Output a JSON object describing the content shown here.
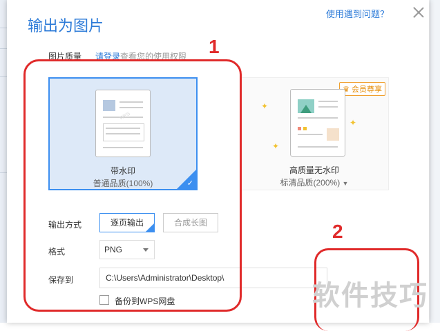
{
  "dialog": {
    "title": "输出为图片",
    "help_link": "使用遇到问题？",
    "quality_label": "图片质量",
    "login_hint_link": "请登录",
    "login_hint_rest": "查看您的使用权限"
  },
  "quality_options": [
    {
      "title": "带水印",
      "subtitle": "普通品质(100%)",
      "selected": true
    },
    {
      "title": "高质量无水印",
      "subtitle": "标清品质(200%)",
      "badge": "会员尊享",
      "selected": false
    }
  ],
  "output": {
    "mode_label": "输出方式",
    "mode_options": [
      "逐页输出",
      "合成长图"
    ],
    "format_label": "格式",
    "format_value": "PNG",
    "save_label": "保存到",
    "save_path": "C:\\Users\\Administrator\\Desktop\\",
    "backup_label": "备份到WPS网盘"
  },
  "annotations": {
    "num1": "1",
    "num2": "2"
  },
  "watermark": "软件技巧",
  "colors": {
    "accent": "#2d7bd8",
    "selected_border": "#3c8ff0",
    "annotation": "#e02a2a",
    "vip": "#e58a00"
  }
}
